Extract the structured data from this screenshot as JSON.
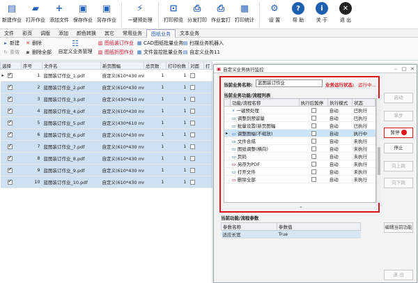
{
  "toolbar": [
    {
      "label": "新建作业",
      "icon": "new-doc-icon",
      "glyph": "▤"
    },
    {
      "label": "打开作业",
      "icon": "folder-open-icon",
      "glyph": "▰"
    },
    {
      "label": "添加文件",
      "icon": "plus-icon",
      "glyph": "+"
    },
    {
      "label": "保存作业",
      "icon": "save-icon",
      "glyph": "▣"
    },
    {
      "label": "另存作业",
      "icon": "save-as-icon",
      "glyph": "▣"
    },
    {
      "label": "一键预处理",
      "icon": "lightning-icon",
      "glyph": "⚡"
    },
    {
      "label": "打印预览",
      "icon": "preview-icon",
      "glyph": "⊡"
    },
    {
      "label": "分发打印",
      "icon": "printer-icon",
      "glyph": "⎙"
    },
    {
      "label": "作业套打",
      "icon": "printer-icon",
      "glyph": "⎙"
    },
    {
      "label": "打印统计",
      "icon": "stats-icon",
      "glyph": "▦"
    },
    {
      "label": "设 置",
      "icon": "gear-icon",
      "glyph": "⚙"
    },
    {
      "label": "帮 助",
      "icon": "help-icon",
      "glyph": "?"
    },
    {
      "label": "关 于",
      "icon": "info-icon",
      "glyph": "i"
    },
    {
      "label": "退 出",
      "icon": "close-icon",
      "glyph": "✕"
    }
  ],
  "menu_tabs": [
    "文件",
    "彩页",
    "调版",
    "添加",
    "颜色转换",
    "其它",
    "常用业务",
    "图纸业务",
    "文本业务"
  ],
  "active_tab": "图纸业务",
  "ribbon": {
    "new": "新建",
    "delete": "删除",
    "redo": "重做",
    "delete_all": "删除全部",
    "custom_mgr": "自定义业务管理",
    "bind_job": "图纸装订作业",
    "fold_job": "图纸折图作业",
    "cad_batch": "CAD图纸批量业务",
    "file_monitor": "文件监控批量业务",
    "scan_input": "扫描业务机器入",
    "custom11": "自定义业务11"
  },
  "table": {
    "headers": [
      "选择",
      "序号",
      "文件名",
      "新页图幅",
      "总页数",
      "打印份数",
      "对面",
      "打"
    ],
    "rows": [
      {
        "checked": true,
        "no": "1",
        "file": "蓝图装订作业_1.pdf",
        "size": "自定义(610*430 mm)",
        "pages": "1",
        "copies": "1",
        "selected": false
      },
      {
        "checked": true,
        "no": "2",
        "file": "蓝图装订作业_2.pdf",
        "size": "自定义(610*430 mm)",
        "pages": "1",
        "copies": "1",
        "selected": true
      },
      {
        "checked": true,
        "no": "3",
        "file": "蓝图装订作业_3.pdf",
        "size": "自定义(430*610 mm)",
        "pages": "1",
        "copies": "1",
        "selected": true
      },
      {
        "checked": true,
        "no": "4",
        "file": "蓝图装订作业_4.pdf",
        "size": "自定义(610*430 mm)",
        "pages": "1",
        "copies": "1",
        "selected": true
      },
      {
        "checked": true,
        "no": "5",
        "file": "蓝图装订作业_5.pdf",
        "size": "自定义(430*610 mm)",
        "pages": "1",
        "copies": "1",
        "selected": true
      },
      {
        "checked": true,
        "no": "6",
        "file": "蓝图装订作业_6.pdf",
        "size": "自定义(610*430 mm)",
        "pages": "1",
        "copies": "1",
        "selected": true
      },
      {
        "checked": true,
        "no": "7",
        "file": "蓝图装订作业_7.pdf",
        "size": "自定义(610*430 mm)",
        "pages": "1",
        "copies": "1",
        "selected": true
      },
      {
        "checked": true,
        "no": "8",
        "file": "蓝图装订作业_8.pdf",
        "size": "自定义(610*430 mm)",
        "pages": "1",
        "copies": "1",
        "selected": true
      },
      {
        "checked": true,
        "no": "9",
        "file": "蓝图装订作业_9.pdf",
        "size": "自定义(610*430 mm)",
        "pages": "1",
        "copies": "1",
        "selected": true
      },
      {
        "checked": true,
        "no": "10",
        "file": "蓝图装订作业_10.pdf",
        "size": "自定义(610*430 mm)",
        "pages": "1",
        "copies": "1",
        "selected": true
      }
    ]
  },
  "dialog": {
    "title": "自定义业务执行监控",
    "name_label": "当前业务名称:",
    "name_value": "蓝图装订作业",
    "status_label": "业务运行状态:",
    "status_value": "运行中...",
    "list_title": "当前业务功能/流程列表",
    "list_headers": [
      "",
      "功能/流程名称",
      "执行后暂停",
      "执行模式",
      "状态"
    ],
    "list_rows": [
      {
        "name": "一键预处理",
        "mode": "自动",
        "status": "已执行",
        "icon": "lightning-icon",
        "glyph": "⚡",
        "sel": false
      },
      {
        "name": "调整到预留量",
        "mode": "自动",
        "status": "已执行",
        "icon": "adjust-icon",
        "glyph": "▭",
        "sel": false
      },
      {
        "name": "批量设置(新页图幅",
        "mode": "自动",
        "status": "已执行",
        "icon": "batch-icon",
        "glyph": "▭",
        "sel": false
      },
      {
        "name": "调整图幅(不缩放)",
        "mode": "自动",
        "status": "执行中",
        "icon": "resize-icon",
        "glyph": "▭",
        "sel": true
      },
      {
        "name": "文件合成",
        "mode": "自动",
        "status": "未执行",
        "icon": "merge-icon",
        "glyph": "▭",
        "sel": false
      },
      {
        "name": "图纸调整(横向)",
        "mode": "自动",
        "status": "未执行",
        "icon": "rotate-icon",
        "glyph": "▭",
        "sel": false
      },
      {
        "name": "页码",
        "mode": "自动",
        "status": "未执行",
        "icon": "page-number-icon",
        "glyph": "▭",
        "sel": false
      },
      {
        "name": "另存为PDF",
        "mode": "自动",
        "status": "未执行",
        "icon": "pdf-icon",
        "glyph": "▭",
        "sel": false
      },
      {
        "name": "打开文件",
        "mode": "自动",
        "status": "未执行",
        "icon": "folder-icon",
        "glyph": "▭",
        "sel": false
      },
      {
        "name": "删除全部",
        "mode": "自动",
        "status": "未执行",
        "icon": "delete-icon",
        "glyph": "▭",
        "sel": false
      }
    ],
    "buttons": {
      "start": "启动",
      "step": "单步",
      "pause": "暂停",
      "stop": "停止",
      "up": "向上跳",
      "down": "向下跳",
      "edit": "编辑当前功能",
      "exit": "退 出"
    },
    "params_title": "当前功能/流程参数",
    "params_headers": [
      "参数名称",
      "参数值"
    ],
    "params_rows": [
      {
        "name": "适应长宽",
        "value": "True"
      }
    ]
  }
}
